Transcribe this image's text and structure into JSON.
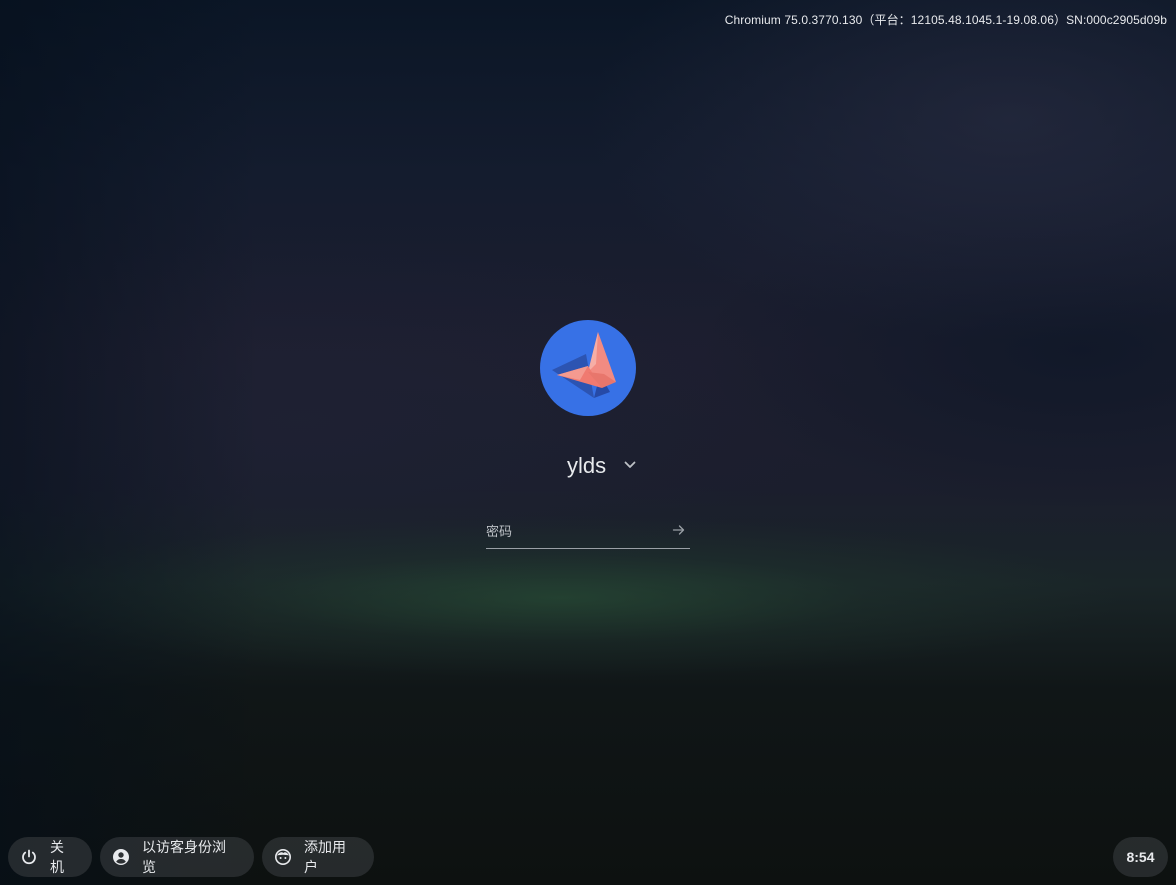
{
  "system_info": {
    "version_text": "Chromium 75.0.3770.130（平台：12105.48.1045.1-19.08.06）SN:000c2905d09b"
  },
  "user_pod": {
    "avatar_icon": "origami-butterfly-avatar",
    "avatar_background": "#3771e6",
    "user_name": "ylds",
    "menu_icon": "chevron-down-icon",
    "password_placeholder": "密码",
    "password_value": "",
    "submit_icon": "arrow-right-icon"
  },
  "shelf": {
    "shutdown_label": "关机",
    "shutdown_icon": "power-icon",
    "guest_label": "以访客身份浏览",
    "guest_icon": "account-circle-icon",
    "add_user_label": "添加用户",
    "add_user_icon": "add-user-icon",
    "clock_time": "8:54"
  }
}
